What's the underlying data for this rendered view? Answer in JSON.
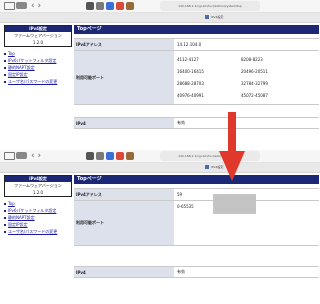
{
  "screens": [
    {
      "toolbar": {
        "url": "192.168.1.1/cgi-bin/luci/admin/system/top",
        "tab_title": "IPv4設定"
      },
      "sidebar": {
        "title": "IPv4設定",
        "firmware_label": "ファームウェアバージョン",
        "firmware_version": "1.2.0",
        "menu": [
          "Top",
          "IPv6パケットフィルタ設定",
          "静的NAPT設定",
          "固定IP設定",
          "ユーザ名/パスワードの変更"
        ]
      },
      "main": {
        "page_title": "Topページ",
        "ipv4_address_label": "IPv4アドレス",
        "ipv4_address_value": "14.12.104.0",
        "ports_label": "利用可能ポート",
        "ports": [
          "4112-4127",
          "8208-8223",
          "16400-16415",
          "20496-20511",
          "28688-28703",
          "32784-32799",
          "40976-40991",
          "45072-45087"
        ],
        "ipv4_label": "IPv4",
        "ipv4_value": "有効"
      }
    },
    {
      "toolbar": {
        "url": "192.168.1.1/cgi-bin/luci/admin/system/top",
        "tab_title": "IPv4設定"
      },
      "sidebar": {
        "title": "IPv4設定",
        "firmware_label": "ファームウェアバージョン",
        "firmware_version": "1.2.0",
        "menu": [
          "Top",
          "IPv6パケットフィルタ設定",
          "静的NAPT設定",
          "固定IP設定",
          "ユーザ名/パスワードの変更"
        ]
      },
      "main": {
        "page_title": "Topページ",
        "ipv4_address_label": "IPv4アドレス",
        "ipv4_address_value": "59",
        "ports_label": "利用可能ポート",
        "ports": [
          "0-65535"
        ],
        "ipv4_label": "IPv4",
        "ipv4_value": "有効"
      }
    }
  ],
  "annotation": {
    "arrow_color": "#e0392c"
  },
  "colors": {
    "header_navy": "#1c2875",
    "label_bg": "#dde1ec",
    "link": "#1a1aa6"
  }
}
